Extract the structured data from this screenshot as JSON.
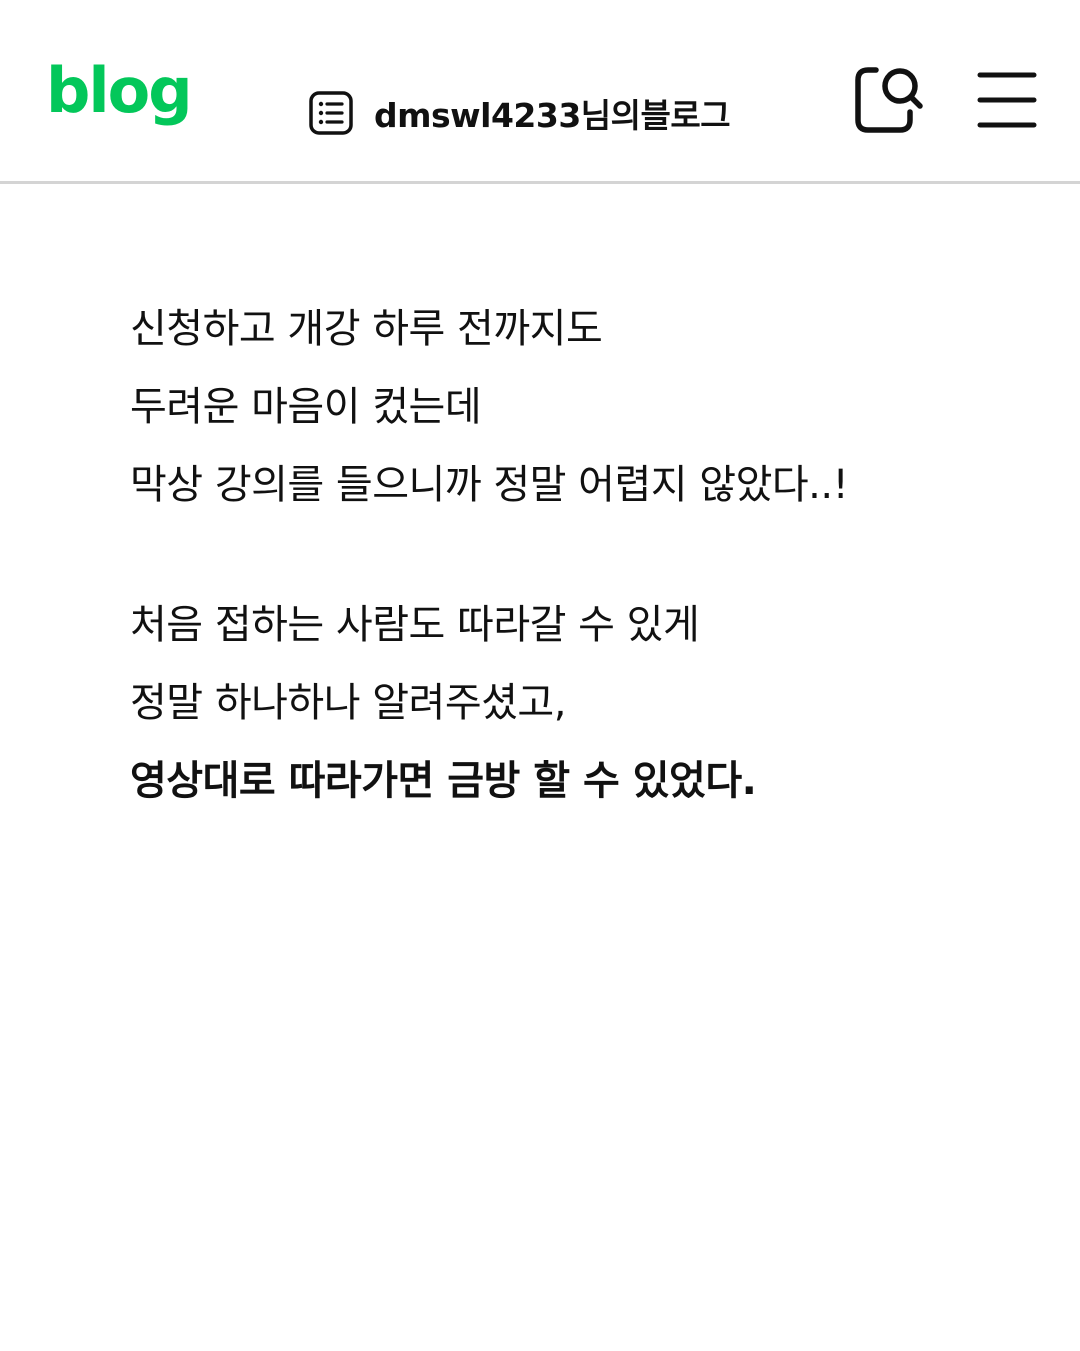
{
  "header": {
    "logo_text": "blog",
    "logo_color": "#03c75a",
    "blog_title": "dmswl4233님의블로그",
    "list_icon": "list-icon",
    "search_icon": "search-icon",
    "menu_icon": "hamburger-menu-icon"
  },
  "post": {
    "paragraph1": [
      "신청하고 개강 하루 전까지도",
      "두려운 마음이 컸는데",
      "막상 강의를 들으니까 정말 어렵지 않았다..!"
    ],
    "paragraph2": [
      "처음 접하는 사람도 따라갈 수 있게",
      "정말 하나하나 알려주셨고,"
    ],
    "highlight": "영상대로 따라가면 금방 할 수 있었다."
  }
}
